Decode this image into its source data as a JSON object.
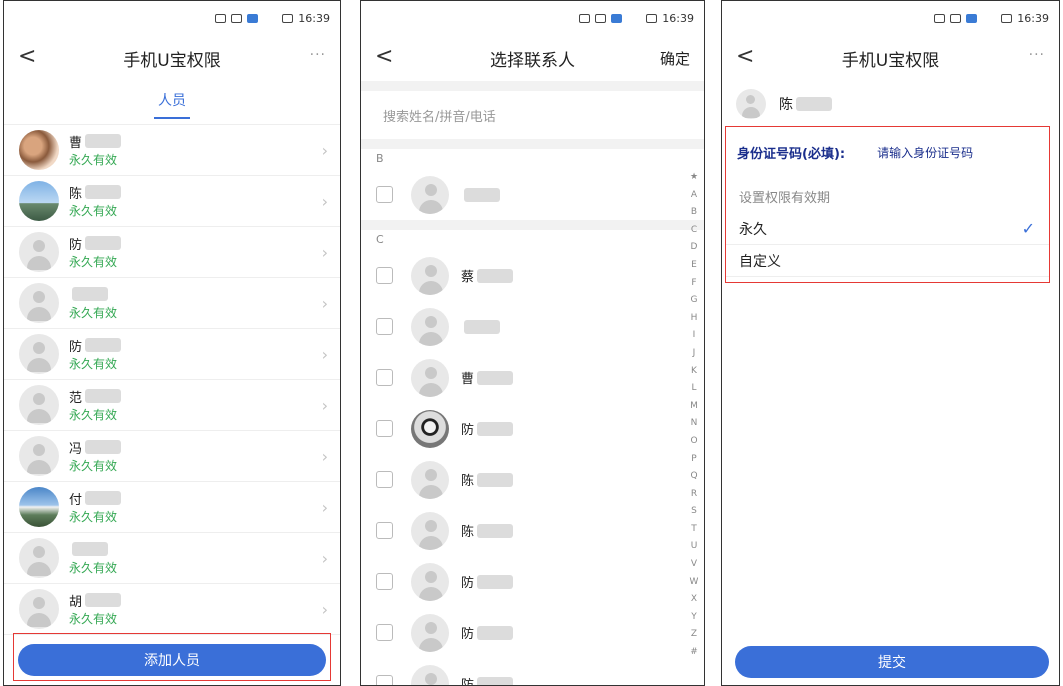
{
  "status": {
    "time": "16:39",
    "battery": "26"
  },
  "screen1": {
    "title": "手机U宝权限",
    "more": "···",
    "tab": "人员",
    "items": [
      {
        "name": "曹",
        "status": "永久有效"
      },
      {
        "name": "陈",
        "status": "永久有效"
      },
      {
        "name": "防",
        "status": "永久有效"
      },
      {
        "name": "",
        "status": "永久有效"
      },
      {
        "name": "防",
        "status": "永久有效"
      },
      {
        "name": "范",
        "status": "永久有效"
      },
      {
        "name": "冯",
        "status": "永久有效"
      },
      {
        "name": "付",
        "status": "永久有效"
      },
      {
        "name": "",
        "status": "永久有效"
      },
      {
        "name": "胡",
        "status": "永久有效"
      }
    ],
    "add_button": "添加人员"
  },
  "screen2": {
    "title": "选择联系人",
    "confirm": "确定",
    "search_placeholder": "搜索姓名/拼音/电话",
    "section_b": "B",
    "section_c": "C",
    "contacts_b": [
      {
        "name": ""
      }
    ],
    "contacts_c": [
      {
        "name": "蔡"
      },
      {
        "name": ""
      },
      {
        "name": "曹"
      },
      {
        "name": "防"
      },
      {
        "name": "陈"
      },
      {
        "name": "陈"
      },
      {
        "name": "防"
      },
      {
        "name": "防"
      },
      {
        "name": "防"
      }
    ],
    "alphabet": [
      "★",
      "A",
      "B",
      "C",
      "D",
      "E",
      "F",
      "G",
      "H",
      "I",
      "J",
      "K",
      "L",
      "M",
      "N",
      "O",
      "P",
      "Q",
      "R",
      "S",
      "T",
      "U",
      "V",
      "W",
      "X",
      "Y",
      "Z",
      "#"
    ]
  },
  "screen3": {
    "title": "手机U宝权限",
    "more": "···",
    "user_name": "陈",
    "id_label": "身份证号码(必填):",
    "id_placeholder": "请输入身份证号码",
    "validity_label": "设置权限有效期",
    "option_permanent": "永久",
    "option_custom": "自定义",
    "submit": "提交"
  }
}
